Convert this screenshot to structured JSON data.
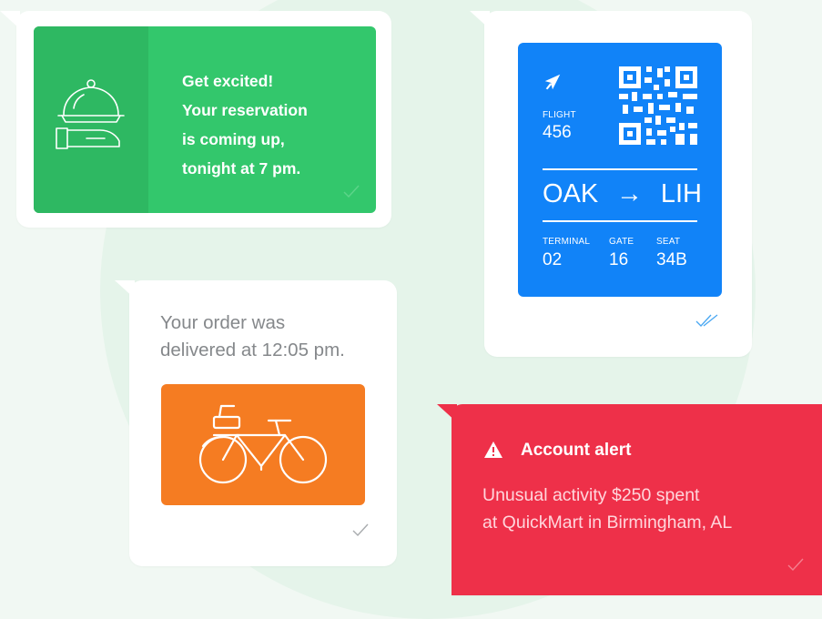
{
  "reservation": {
    "message": "Get excited! Your reservation is coming up, tonight at 7 pm.",
    "lines": [
      "Get excited!",
      "Your reservation",
      "is coming up,",
      "tonight at 7 pm."
    ],
    "icon": "serving-cloche-icon",
    "status_icon": "check-icon",
    "colors": {
      "card": "#33c76c",
      "side": "#2eb862"
    }
  },
  "boarding_pass": {
    "flight_label": "FLIGHT",
    "flight_number": "456",
    "origin": "OAK",
    "arrow": "→",
    "destination": "LIH",
    "terminal_label": "TERMINAL",
    "terminal": "02",
    "gate_label": "GATE",
    "gate": "16",
    "seat_label": "SEAT",
    "seat": "34B",
    "icons": [
      "airplane-icon",
      "qr-code-icon"
    ],
    "status_icon": "double-check-icon",
    "colors": {
      "card": "#1183f8"
    }
  },
  "delivery": {
    "lines": [
      "Your order was",
      "delivered at 12:05 pm."
    ],
    "icon": "bicycle-icon",
    "status_icon": "check-icon",
    "colors": {
      "card": "#f57c22"
    }
  },
  "alert": {
    "title": "Account alert",
    "body_lines": [
      "Unusual activity $250 spent",
      "at QuickMart in Birmingham, AL"
    ],
    "icon": "warning-icon",
    "status_icon": "check-icon",
    "colors": {
      "card": "#ee3049"
    }
  }
}
